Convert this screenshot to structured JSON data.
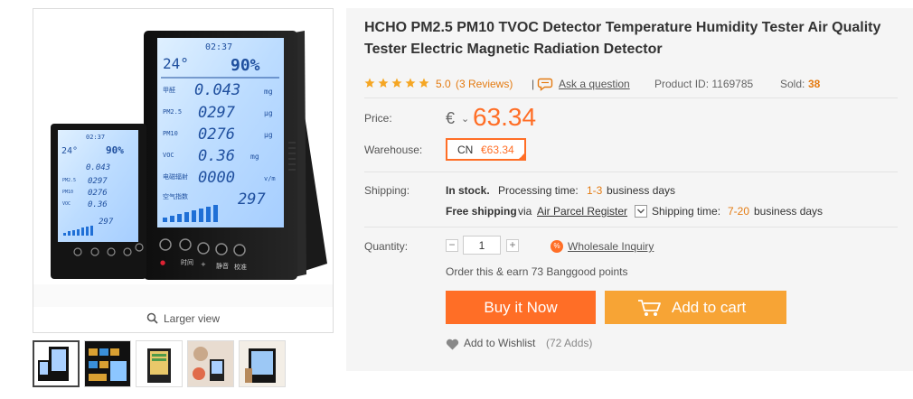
{
  "product": {
    "title_line1": "HCHO PM2.5 PM10 TVOC Detector Temperature Humidity Tester Air Quality",
    "title_line2": "Tester Electric Magnetic Radiation Detector",
    "rating_stars": 5,
    "rating": "5.0",
    "reviews": "(3 Reviews)",
    "separator": "|",
    "ask_question": "Ask a question",
    "product_id": "Product ID: 1169785",
    "sold_label": "Sold:",
    "sold_value": "38"
  },
  "price": {
    "label": "Price:",
    "currency": "€",
    "value": "63.34"
  },
  "warehouse": {
    "label": "Warehouse:",
    "code": "CN",
    "price": "€63.34"
  },
  "shipping": {
    "label": "Shipping:",
    "status": "In stock.",
    "processing_label": "Processing time:",
    "processing_value": "1-3",
    "processing_unit": "business days",
    "free_label": "Free shipping",
    "via": "via",
    "method": "Air Parcel Register",
    "time_label": "Shipping time:",
    "time_value": "7-20",
    "time_unit": "business days"
  },
  "quantity": {
    "label": "Quantity:",
    "minus": "−",
    "value": "1",
    "plus": "+",
    "wholesale": "Wholesale Inquiry",
    "wholesale_badge": "%"
  },
  "points": "Order this & earn 73 Banggood points",
  "buttons": {
    "buy": "Buy it Now",
    "cart": "Add to cart"
  },
  "wishlist": {
    "label": "Add to Wishlist",
    "count": "(72 Adds)"
  },
  "gallery": {
    "larger_view": "Larger view",
    "thumbnail_count": 5
  },
  "device_screen": {
    "time": "02:37",
    "temperature": "24°",
    "humidity": "90%",
    "hcho_label": "甲醛",
    "hcho_value": "0.043",
    "pm25_label": "PM2.5",
    "pm25_value": "0297",
    "pm10_label": "PM10",
    "pm10_value": "0276",
    "voc_label": "VOC",
    "voc_value": "0.36",
    "radiation_label": "电磁辐射",
    "radiation_value": "0000",
    "aqi_label": "空气指数",
    "aqi_value": "297",
    "unit_mg": "mg",
    "unit_ug": "μg",
    "unit_vm": "v/m",
    "btn_time": "时间",
    "btn_plus": "+",
    "btn_mute": "静音",
    "btn_calibrate": "校准"
  },
  "colors": {
    "accent_orange": "#ff6e26",
    "cart_orange": "#f7a435",
    "link_orange": "#e47b12",
    "star": "#f5a623",
    "panel_bg": "#f5f5f5",
    "lcd_blue": "#1f6fd6"
  },
  "icons": [
    "magnifier-icon",
    "chat-bubble-icon",
    "chevron-down-icon",
    "percent-badge-icon",
    "shopping-cart-icon",
    "heart-icon",
    "checkmark-icon"
  ]
}
